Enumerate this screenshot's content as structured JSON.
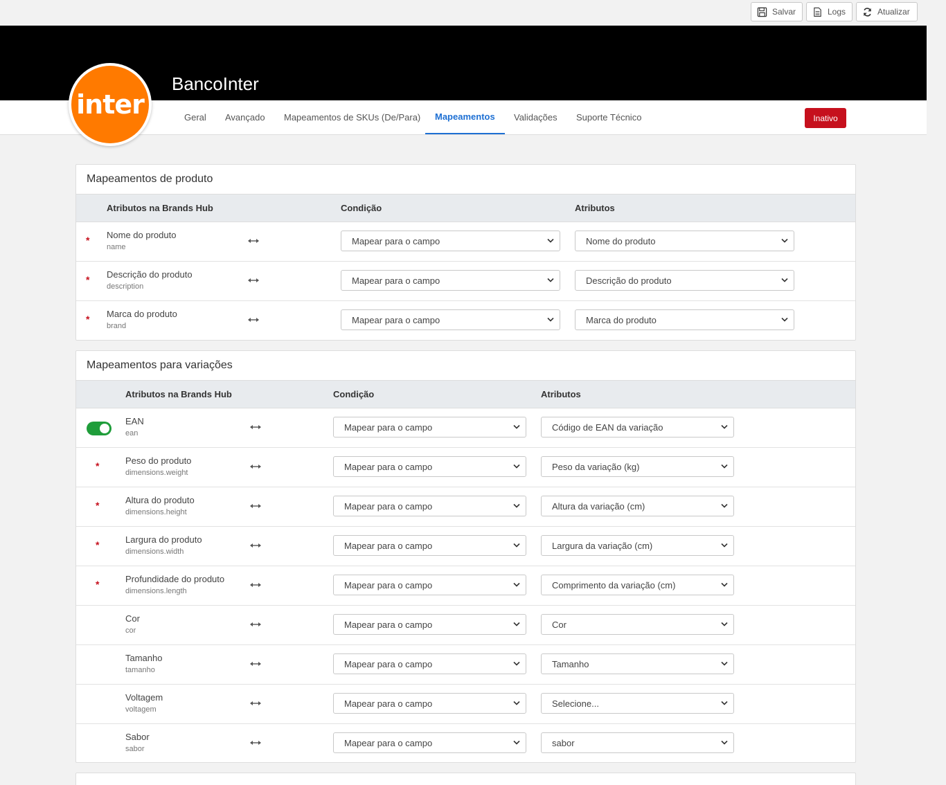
{
  "toolbar": {
    "save_label": "Salvar",
    "logs_label": "Logs",
    "refresh_label": "Atualizar"
  },
  "header": {
    "title": "BancoInter",
    "logo_text": "inter",
    "logo_color": "#ff7a00",
    "status_label": "Inativo",
    "status_color": "#c6101d"
  },
  "nav": {
    "tabs": [
      {
        "label": "Geral"
      },
      {
        "label": "Avançado"
      },
      {
        "label": "Mapeamentos de SKUs (De/Para)"
      },
      {
        "label": "Mapeamentos",
        "active": true
      },
      {
        "label": "Validações"
      },
      {
        "label": "Suporte Técnico"
      }
    ],
    "accent": "#1d6fd3"
  },
  "product_panel": {
    "title": "Mapeamentos de produto",
    "headers": {
      "attr": "Atributos na Brands Hub",
      "cond": "Condição",
      "attrs": "Atributos"
    },
    "rows": [
      {
        "required": "*",
        "name": "Nome do produto",
        "key": "name",
        "condition": "Mapear para o campo",
        "attribute": "Nome do produto"
      },
      {
        "required": "*",
        "name": "Descrição do produto",
        "key": "description",
        "condition": "Mapear para o campo",
        "attribute": "Descrição do produto"
      },
      {
        "required": "*",
        "name": "Marca do produto",
        "key": "brand",
        "condition": "Mapear para o campo",
        "attribute": "Marca do produto"
      }
    ]
  },
  "variation_panel": {
    "title": "Mapeamentos para variações",
    "headers": {
      "attr": "Atributos na Brands Hub",
      "cond": "Condição",
      "attrs": "Atributos"
    },
    "rows": [
      {
        "toggle": true,
        "name": "EAN",
        "key": "ean",
        "condition": "Mapear para o campo",
        "attribute": "Código de EAN da variação"
      },
      {
        "required": "*",
        "name": "Peso do produto",
        "key": "dimensions.weight",
        "condition": "Mapear para o campo",
        "attribute": "Peso da variação (kg)"
      },
      {
        "required": "*",
        "name": "Altura do produto",
        "key": "dimensions.height",
        "condition": "Mapear para o campo",
        "attribute": "Altura da variação (cm)"
      },
      {
        "required": "*",
        "name": "Largura do produto",
        "key": "dimensions.width",
        "condition": "Mapear para o campo",
        "attribute": "Largura da variação (cm)"
      },
      {
        "required": "*",
        "name": "Profundidade do produto",
        "key": "dimensions.length",
        "condition": "Mapear para o campo",
        "attribute": "Comprimento da variação (cm)"
      },
      {
        "name": "Cor",
        "key": "cor",
        "condition": "Mapear para o campo",
        "attribute": "Cor"
      },
      {
        "name": "Tamanho",
        "key": "tamanho",
        "condition": "Mapear para o campo",
        "attribute": "Tamanho"
      },
      {
        "name": "Voltagem",
        "key": "voltagem",
        "condition": "Mapear para o campo",
        "attribute": "Selecione..."
      },
      {
        "name": "Sabor",
        "key": "sabor",
        "condition": "Mapear para o campo",
        "attribute": "sabor"
      }
    ]
  }
}
